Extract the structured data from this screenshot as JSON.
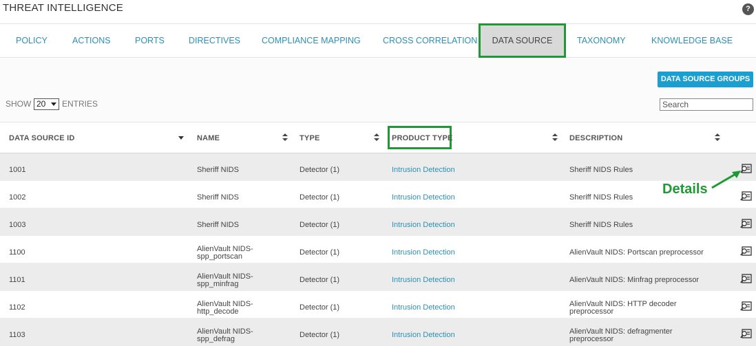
{
  "header": {
    "title": "THREAT INTELLIGENCE",
    "help_glyph": "?"
  },
  "tabs": [
    {
      "label": "POLICY",
      "active": false
    },
    {
      "label": "ACTIONS",
      "active": false
    },
    {
      "label": "PORTS",
      "active": false
    },
    {
      "label": "DIRECTIVES",
      "active": false
    },
    {
      "label": "COMPLIANCE MAPPING",
      "active": false
    },
    {
      "label": "CROSS CORRELATION",
      "active": false
    },
    {
      "label": "DATA SOURCE",
      "active": true
    },
    {
      "label": "TAXONOMY",
      "active": false
    },
    {
      "label": "KNOWLEDGE BASE",
      "active": false
    }
  ],
  "toolbar": {
    "groups_button": "DATA SOURCE GROUPS",
    "show_label": "SHOW",
    "entries_value": "20",
    "entries_label": "ENTRIES",
    "search_placeholder": "Search"
  },
  "table": {
    "columns": [
      "DATA SOURCE ID",
      "NAME",
      "TYPE",
      "PRODUCT TYPE",
      "DESCRIPTION"
    ],
    "rows": [
      {
        "id": "1001",
        "name": [
          "Sheriff NIDS"
        ],
        "type": "Detector (1)",
        "product_type": "Intrusion Detection",
        "description": [
          "Sheriff NIDS Rules"
        ]
      },
      {
        "id": "1002",
        "name": [
          "Sheriff NIDS"
        ],
        "type": "Detector (1)",
        "product_type": "Intrusion Detection",
        "description": [
          "Sheriff NIDS Rules"
        ]
      },
      {
        "id": "1003",
        "name": [
          "Sheriff NIDS"
        ],
        "type": "Detector (1)",
        "product_type": "Intrusion Detection",
        "description": [
          "Sheriff NIDS Rules"
        ]
      },
      {
        "id": "1100",
        "name": [
          "AlienVault NIDS-",
          "spp_portscan"
        ],
        "type": "Detector (1)",
        "product_type": "Intrusion Detection",
        "description": [
          "AlienVault NIDS: Portscan preprocessor"
        ]
      },
      {
        "id": "1101",
        "name": [
          "AlienVault NIDS-",
          "spp_minfrag"
        ],
        "type": "Detector (1)",
        "product_type": "Intrusion Detection",
        "description": [
          "AlienVault NIDS: Minfrag preprocessor"
        ]
      },
      {
        "id": "1102",
        "name": [
          "AlienVault NIDS-",
          "http_decode"
        ],
        "type": "Detector (1)",
        "product_type": "Intrusion Detection",
        "description": [
          "AlienVault NIDS: HTTP decoder",
          "preprocessor"
        ]
      },
      {
        "id": "1103",
        "name": [
          "AlienVault NIDS-",
          "spp_defrag"
        ],
        "type": "Detector (1)",
        "product_type": "Intrusion Detection",
        "description": [
          "AlienVault NIDS: defragmenter",
          "preprocessor"
        ]
      }
    ]
  },
  "annotation": {
    "label": "Details",
    "color": "#1e9a35"
  },
  "colors": {
    "accent": "#1a9fd0",
    "link": "#2e8fb3",
    "highlight": "#1e9a35"
  }
}
